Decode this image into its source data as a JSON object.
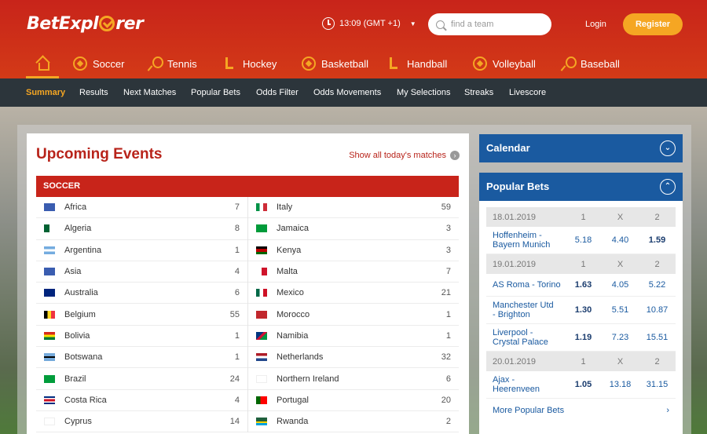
{
  "brand": {
    "name_left": "BetExpl",
    "name_right": "rer"
  },
  "header": {
    "time": "13:09 (GMT +1)",
    "search_placeholder": "find a team",
    "login": "Login",
    "register": "Register"
  },
  "sports": [
    "Soccer",
    "Tennis",
    "Hockey",
    "Basketball",
    "Handball",
    "Volleyball",
    "Baseball"
  ],
  "subnav": [
    "Summary",
    "Results",
    "Next Matches",
    "Popular Bets",
    "Odds Filter",
    "Odds Movements",
    "My Selections",
    "Streaks",
    "Livescore"
  ],
  "upcoming": {
    "title": "Upcoming Events",
    "show_all": "Show all today's matches",
    "sport": "SOCCER",
    "left": [
      {
        "country": "Africa",
        "count": "7"
      },
      {
        "country": "Algeria",
        "count": "8"
      },
      {
        "country": "Argentina",
        "count": "1"
      },
      {
        "country": "Asia",
        "count": "4"
      },
      {
        "country": "Australia",
        "count": "6"
      },
      {
        "country": "Belgium",
        "count": "55"
      },
      {
        "country": "Bolivia",
        "count": "1"
      },
      {
        "country": "Botswana",
        "count": "1"
      },
      {
        "country": "Brazil",
        "count": "24"
      },
      {
        "country": "Costa Rica",
        "count": "4"
      },
      {
        "country": "Cyprus",
        "count": "14"
      }
    ],
    "right": [
      {
        "country": "Italy",
        "count": "59"
      },
      {
        "country": "Jamaica",
        "count": "3"
      },
      {
        "country": "Kenya",
        "count": "3"
      },
      {
        "country": "Malta",
        "count": "7"
      },
      {
        "country": "Mexico",
        "count": "21"
      },
      {
        "country": "Morocco",
        "count": "1"
      },
      {
        "country": "Namibia",
        "count": "1"
      },
      {
        "country": "Netherlands",
        "count": "32"
      },
      {
        "country": "Northern Ireland",
        "count": "6"
      },
      {
        "country": "Portugal",
        "count": "20"
      },
      {
        "country": "Rwanda",
        "count": "2"
      }
    ]
  },
  "calendar": {
    "title": "Calendar"
  },
  "popular": {
    "title": "Popular Bets",
    "days": [
      {
        "date": "18.01.2019",
        "h1": "1",
        "hx": "X",
        "h2": "2",
        "matches": [
          {
            "l1": "Hoffenheim -",
            "l2": "Bayern Munich",
            "o1": "5.18",
            "ox": "4.40",
            "o2": "1.59"
          }
        ]
      },
      {
        "date": "19.01.2019",
        "h1": "1",
        "hx": "X",
        "h2": "2",
        "matches": [
          {
            "l1": "AS Roma - Torino",
            "l2": "",
            "o1": "1.63",
            "ox": "4.05",
            "o2": "5.22"
          },
          {
            "l1": "Manchester Utd",
            "l2": "- Brighton",
            "o1": "1.30",
            "ox": "5.51",
            "o2": "10.87"
          },
          {
            "l1": "Liverpool -",
            "l2": "Crystal Palace",
            "o1": "1.19",
            "ox": "7.23",
            "o2": "15.51"
          }
        ]
      },
      {
        "date": "20.01.2019",
        "h1": "1",
        "hx": "X",
        "h2": "2",
        "matches": [
          {
            "l1": "Ajax -",
            "l2": "Heerenveen",
            "o1": "1.05",
            "ox": "13.18",
            "o2": "31.15"
          }
        ]
      }
    ],
    "more": "More Popular Bets"
  }
}
